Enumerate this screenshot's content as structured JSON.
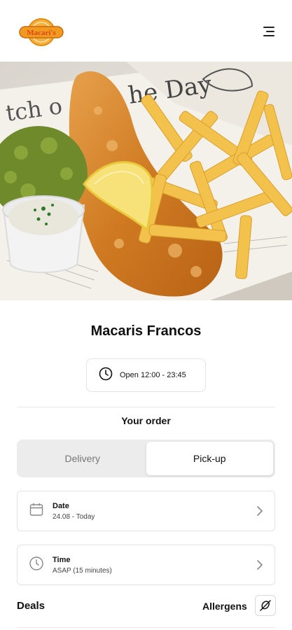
{
  "header": {
    "logo_text": "Macari's",
    "menu_icon": "hamburger-menu-icon"
  },
  "hero": {
    "image_icon": "fish-and-chips-photo"
  },
  "restaurant": {
    "name": "Macaris Francos",
    "hours": "Open 12:00 - 23:45",
    "hours_icon": "clock-icon"
  },
  "order": {
    "heading": "Your order",
    "modes": [
      "Delivery",
      "Pick-up"
    ],
    "selected_mode": "Pick-up"
  },
  "date": {
    "label": "Date",
    "value": "24.08 - Today",
    "icon": "calendar-icon"
  },
  "time": {
    "label": "Time",
    "value": "ASAP (15 minutes)",
    "icon": "clock-icon"
  },
  "sections": {
    "deals": "Deals",
    "allergens": "Allergens",
    "allergens_icon": "no-allergen-icon"
  },
  "colors": {
    "logo_orange": "#f29a1f",
    "logo_red": "#d9481c",
    "text": "#111111",
    "border": "#e3e3e3",
    "segment_bg": "#ececec"
  }
}
